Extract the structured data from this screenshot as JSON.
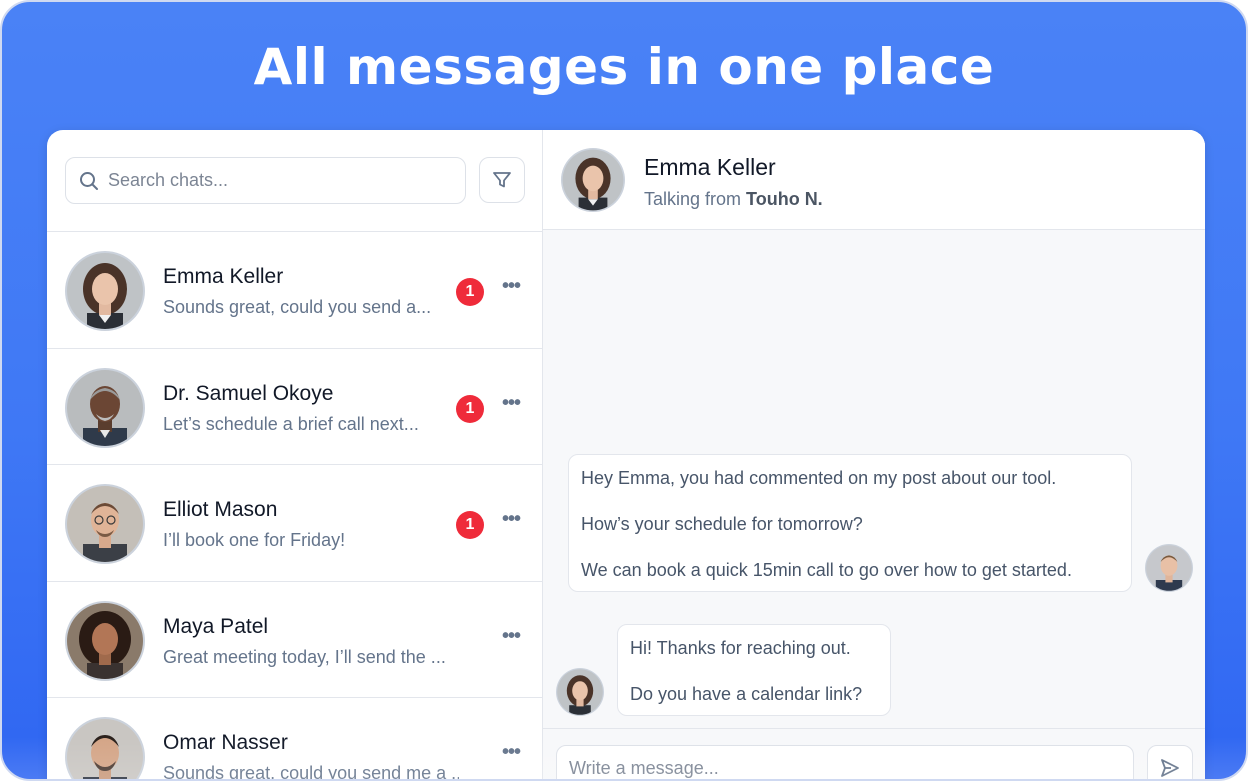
{
  "colors": {
    "brand_blue": "#3f78f5",
    "badge_red": "#ef2b3a",
    "text_dark": "#111827",
    "text_muted": "#64748b"
  },
  "headline": "All messages in one place",
  "sidebar": {
    "search": {
      "placeholder": "Search chats...",
      "value": "",
      "icon": "search-icon"
    },
    "filter_icon": "filter-icon",
    "chats": [
      {
        "name": "Emma Keller",
        "preview": "Sounds great, could you send a...",
        "unread": "1",
        "more": "•••",
        "avatar": "avatar-emma"
      },
      {
        "name": "Dr. Samuel Okoye",
        "preview": "Let’s schedule a brief call next...",
        "unread": "1",
        "more": "•••",
        "avatar": "avatar-samuel"
      },
      {
        "name": "Elliot Mason",
        "preview": "I’ll book one for Friday!",
        "unread": "1",
        "more": "•••",
        "avatar": "avatar-elliot"
      },
      {
        "name": "Maya Patel",
        "preview": "Great meeting today, I’ll send the ...",
        "unread": "",
        "more": "•••",
        "avatar": "avatar-maya"
      },
      {
        "name": "Omar Nasser",
        "preview": "Sounds great, could you send me a ....",
        "unread": "",
        "more": "•••",
        "avatar": "avatar-omar"
      }
    ]
  },
  "chat": {
    "header": {
      "name": "Emma Keller",
      "sub_prefix": "Talking from",
      "sub_account": "Touho N."
    },
    "messages": [
      {
        "from": "me",
        "lines": [
          "Hey Emma, you had commented on my post about our tool.",
          "How’s your schedule for tomorrow?",
          "We can book a quick 15min call to go over how to get started."
        ]
      },
      {
        "from": "contact",
        "lines": [
          "Hi! Thanks for reaching out.",
          "Do you have a calendar link?"
        ]
      }
    ],
    "composer": {
      "placeholder": "Write a message...",
      "value": "",
      "send_icon": "send-icon"
    }
  }
}
